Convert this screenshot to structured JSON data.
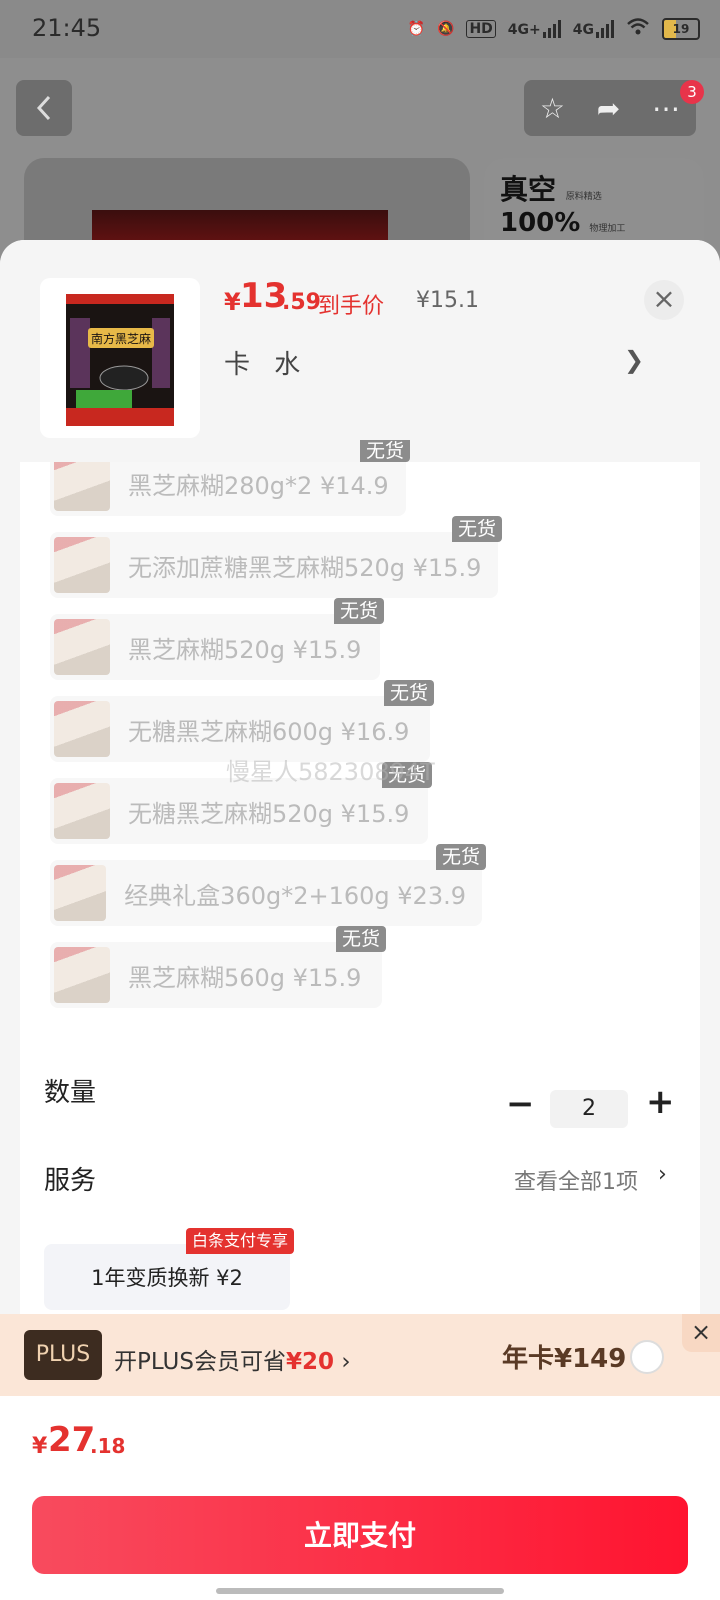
{
  "status": {
    "time": "21:45",
    "battery": "19",
    "hd": "HD",
    "net1": "4G+",
    "net2": "4G"
  },
  "topbar": {
    "cart_count": "3"
  },
  "promo": {
    "line1": "真空",
    "line1_small": "原料精选",
    "line2": "100%",
    "line2_small": "物理加工"
  },
  "sheet": {
    "price_currency": "¥",
    "price_int": "13",
    "price_dec": ".59",
    "price_tag": "到手价",
    "original_price": "¥15.1",
    "selected_spec": "卡 水",
    "close": "×"
  },
  "options": [
    {
      "label": "黑芝麻糊280g*2  ¥14.9",
      "badge": "无货"
    },
    {
      "label": "无添加蔗糖黑芝麻糊520g  ¥15.9",
      "badge": "无货"
    },
    {
      "label": "黑芝麻糊520g  ¥15.9",
      "badge": "无货"
    },
    {
      "label": "无糖黑芝麻糊600g  ¥16.9",
      "badge": "无货"
    },
    {
      "label": "无糖黑芝麻糊520g  ¥15.9",
      "badge": "无货"
    },
    {
      "label": "经典礼盒360g*2+160g  ¥23.9",
      "badge": "无货"
    },
    {
      "label": "黑芝麻糊560g  ¥15.9",
      "badge": "无货"
    }
  ],
  "watermark": "慢星人58230894T",
  "quantity": {
    "label": "数量",
    "value": "2",
    "minus": "−",
    "plus": "+"
  },
  "service": {
    "label": "服务",
    "view_all": "查看全部1项",
    "chevron": "›",
    "item": "1年变质换新  ¥2",
    "tag": "白条支付专享"
  },
  "plus": {
    "logo": "PLUS",
    "text": "开PLUS会员可省",
    "save": "¥20",
    "chevron": "›",
    "year_card": "年卡¥149",
    "close": "×"
  },
  "footer": {
    "total_currency": "¥",
    "total_int": "27",
    "total_dec": ".18",
    "pay_label": "立即支付"
  },
  "colors": {
    "accent": "#e4322f",
    "pay_button": "#ff1430",
    "oos_badge": "#8c8c8c",
    "plus_bg": "#fbe6d7"
  }
}
